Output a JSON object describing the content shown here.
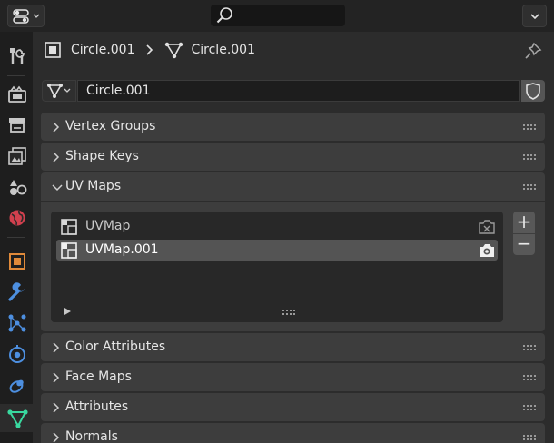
{
  "breadcrumb": {
    "object_name": "Circle.001",
    "mesh_name": "Circle.001"
  },
  "datablock": {
    "name": "Circle.001"
  },
  "panels": {
    "vertex_groups": "Vertex Groups",
    "shape_keys": "Shape Keys",
    "uv_maps": "UV Maps",
    "color_attributes": "Color Attributes",
    "face_maps": "Face Maps",
    "attributes": "Attributes",
    "normals": "Normals"
  },
  "uv_maps": [
    {
      "name": "UVMap",
      "selected": false
    },
    {
      "name": "UVMap.001",
      "selected": true
    }
  ],
  "list_buttons": {
    "add": "+",
    "remove": "−"
  },
  "colors": {
    "accent_active_tab": "#39d89f",
    "panel_bg": "#3d3d3d",
    "selected_row": "#545454"
  },
  "tabs": [
    "tool-icon",
    "render-icon",
    "output-icon",
    "view-layer-icon",
    "scene-icon",
    "world-icon",
    "object-icon",
    "modifier-icon",
    "particles-icon",
    "physics-icon",
    "constraints-icon",
    "mesh-data-icon"
  ]
}
